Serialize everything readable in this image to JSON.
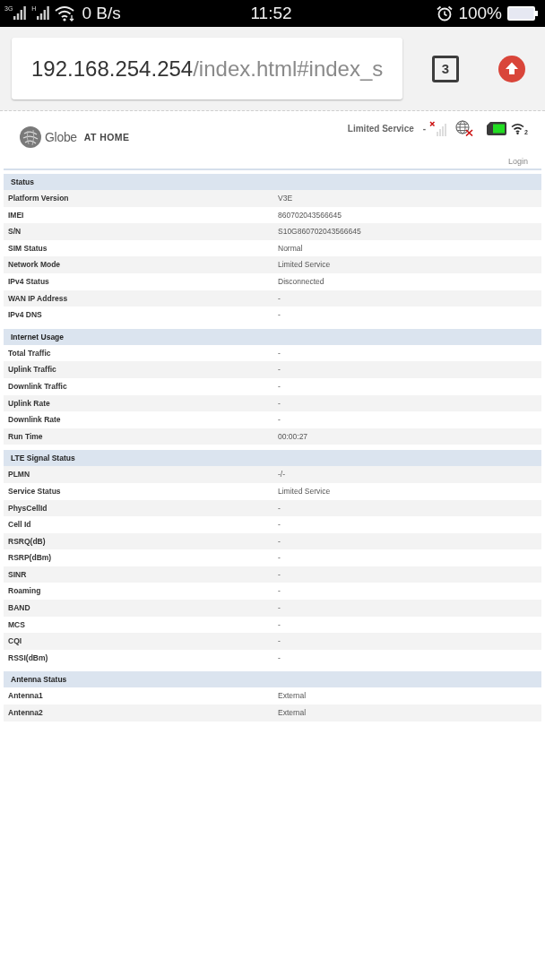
{
  "status_bar": {
    "signals": [
      {
        "label": "3G"
      },
      {
        "label": "H"
      }
    ],
    "speed": "0 B/s",
    "time": "11:52",
    "battery": "100%"
  },
  "browser": {
    "url_host": "192.168.254.254",
    "url_path": "/index.html#index_s",
    "tab_count": "3"
  },
  "header": {
    "brand": "Globe",
    "brand_suffix": "AT HOME",
    "network_status": "Limited Service",
    "separator": "-",
    "wifi_clients": "2",
    "login": "Login"
  },
  "sections": [
    {
      "title": "Status",
      "rows": [
        {
          "label": "Platform Version",
          "value": "V3E"
        },
        {
          "label": "IMEI",
          "value": "860702043566645"
        },
        {
          "label": "S/N",
          "value": "S10G860702043566645"
        },
        {
          "label": "SIM Status",
          "value": "Normal"
        },
        {
          "label": "Network Mode",
          "value": "Limited Service"
        },
        {
          "label": "IPv4 Status",
          "value": "Disconnected"
        },
        {
          "label": "WAN IP Address",
          "value": "-"
        },
        {
          "label": "IPv4 DNS",
          "value": "-"
        }
      ]
    },
    {
      "title": "Internet Usage",
      "rows": [
        {
          "label": "Total Traffic",
          "value": "-"
        },
        {
          "label": "Uplink Traffic",
          "value": "-"
        },
        {
          "label": "Downlink Traffic",
          "value": "-"
        },
        {
          "label": "Uplink Rate",
          "value": "-"
        },
        {
          "label": "Downlink Rate",
          "value": "-"
        },
        {
          "label": "Run Time",
          "value": "00:00:27"
        }
      ]
    },
    {
      "title": "LTE Signal Status",
      "rows": [
        {
          "label": "PLMN",
          "value": "-/-"
        },
        {
          "label": "Service Status",
          "value": "Limited Service"
        },
        {
          "label": "PhysCellId",
          "value": "-"
        },
        {
          "label": "Cell Id",
          "value": "-"
        },
        {
          "label": "RSRQ(dB)",
          "value": "-"
        },
        {
          "label": "RSRP(dBm)",
          "value": "-"
        },
        {
          "label": "SINR",
          "value": "-"
        },
        {
          "label": "Roaming",
          "value": "-"
        },
        {
          "label": "BAND",
          "value": "-"
        },
        {
          "label": "MCS",
          "value": "-"
        },
        {
          "label": "CQI",
          "value": "-"
        },
        {
          "label": "RSSI(dBm)",
          "value": "-"
        }
      ]
    },
    {
      "title": "Antenna Status",
      "rows": [
        {
          "label": "Antenna1",
          "value": "External"
        },
        {
          "label": "Antenna2",
          "value": "External"
        }
      ]
    }
  ]
}
